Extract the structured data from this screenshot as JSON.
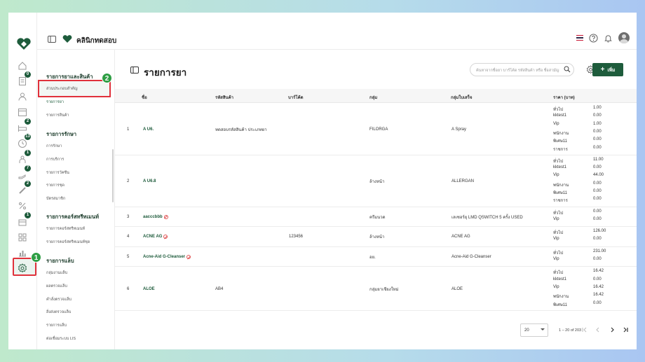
{
  "app": {
    "clinic_name": "คลินิกทดสอบ",
    "logo_color": "#1e5c3c"
  },
  "rail": {
    "icons": [
      {
        "name": "home-icon",
        "badge": ""
      },
      {
        "name": "document-icon",
        "badge": "0"
      },
      {
        "name": "user-icon",
        "badge": ""
      },
      {
        "name": "calendar-icon",
        "badge": ""
      },
      {
        "name": "bed-icon",
        "badge": "2"
      },
      {
        "name": "clock-icon",
        "badge": "13"
      },
      {
        "name": "person-icon",
        "badge": "1"
      },
      {
        "name": "hand-icon",
        "badge": "7"
      },
      {
        "name": "syringe-icon",
        "badge": "2"
      },
      {
        "name": "percent-icon",
        "badge": ""
      },
      {
        "name": "box-icon",
        "badge": "1"
      },
      {
        "name": "grid-icon",
        "badge": ""
      },
      {
        "name": "bar-chart-icon",
        "badge": ""
      },
      {
        "name": "settings-icon",
        "badge": ""
      }
    ],
    "step_1": "1"
  },
  "subnav": {
    "sections": [
      {
        "title": "รายการยาและสินค้า",
        "items": [
          "ส่วนประกอบสำคัญ",
          "รายการยา",
          "รายการสินค้า"
        ]
      },
      {
        "title": "รายการรักษา",
        "items": [
          "การรักษา",
          "การบริการ",
          "รายการวัคซีน",
          "รายการชุด",
          "บัตรสมาชิก"
        ]
      },
      {
        "title": "รายการคอร์สทรีทเมนท์",
        "items": [
          "รายการคอร์สทรีทเมนท์",
          "รายการคอร์สทรีทเมนท์ชุด"
        ]
      },
      {
        "title": "รายการแล็บ",
        "items": [
          "กลุ่มงานแล็บ",
          "ผลตรวจแล็บ",
          "คำสั่งตรวจแล็บ",
          "สิ่งส่งตรวจแล็บ",
          "รายการแล็บ",
          "ต่อเชื่อมระบบ LIS"
        ]
      }
    ],
    "step_2": "2"
  },
  "main": {
    "title": "รายการยา",
    "search_placeholder": "ค้นหาจากชื่อยา บาร์โค้ด รหัสสินค้า หรือ ชื่อสามัญ",
    "add_label": "เพิ่ม",
    "columns": [
      "ชื่อ",
      "รหัสสินค้า",
      "บาร์โค้ด",
      "กลุ่ม",
      "กลุ่มใบเสร็จ",
      "ราคา (บาท)"
    ],
    "rows": [
      {
        "no": "1",
        "name": "A U6.",
        "banned": false,
        "code": "ทดสอบรหัสสินค้า ประเภทยา",
        "barcode": "",
        "group": "FILORGA",
        "receipt_group": "A Spray",
        "prices": [
          [
            "ทั่วไป",
            "1.00"
          ],
          [
            "kktest1",
            "0.00"
          ],
          [
            "Vip",
            "1.00"
          ],
          [
            "พนักงาน",
            "0.00"
          ],
          [
            "พิเศษ11",
            "0.00"
          ],
          [
            "ราชการ",
            "0.00"
          ]
        ]
      },
      {
        "no": "2",
        "name": "A U6.8",
        "banned": false,
        "code": "",
        "barcode": "",
        "group": "ล้างหน้า",
        "receipt_group": "ALLERGAN",
        "prices": [
          [
            "ทั่วไป",
            "11.00"
          ],
          [
            "kktest1",
            "0.00"
          ],
          [
            "Vip",
            "44.00"
          ],
          [
            "พนักงาน",
            "0.00"
          ],
          [
            "พิเศษ11",
            "0.00"
          ],
          [
            "ราชการ",
            "0.00"
          ]
        ]
      },
      {
        "no": "3",
        "name": "aacccbbb",
        "banned": true,
        "code": "",
        "barcode": "",
        "group": "ครีมนวด",
        "receipt_group": "เลเซอร์ยุ LMD QSWITCH 5 ครั้ง USED",
        "prices": [
          [
            "ทั่วไป",
            "0.00"
          ],
          [
            "Vip",
            "0.00"
          ]
        ]
      },
      {
        "no": "4",
        "name": "ACNE AG",
        "banned": true,
        "code": "",
        "barcode": "123456",
        "group": "ล้างหน้า",
        "receipt_group": "ACNE AG",
        "prices": [
          [
            "ทั่วไป",
            "126.00"
          ],
          [
            "Vip",
            "0.00"
          ]
        ]
      },
      {
        "no": "5",
        "name": "Acne-Aid G-Cleanser",
        "banned": true,
        "code": "",
        "barcode": "",
        "group": "อย.",
        "receipt_group": "Acne-Aid G-Cleanser",
        "prices": [
          [
            "ทั่วไป",
            "231.00"
          ],
          [
            "Vip",
            "0.00"
          ]
        ]
      },
      {
        "no": "6",
        "name": "ALOE",
        "banned": false,
        "code": "AB4",
        "barcode": "",
        "group": "กลุ่มยาเชียงใหม่",
        "receipt_group": "ALOE",
        "prices": [
          [
            "ทั่วไป",
            "16.42"
          ],
          [
            "kktest1",
            "0.00"
          ],
          [
            "Vip",
            "16.42"
          ],
          [
            "พนักงาน",
            "16.42"
          ],
          [
            "พิเศษ11",
            "0.00"
          ]
        ]
      }
    ],
    "page_size": "20",
    "page_info": "1 – 20 of 203"
  }
}
